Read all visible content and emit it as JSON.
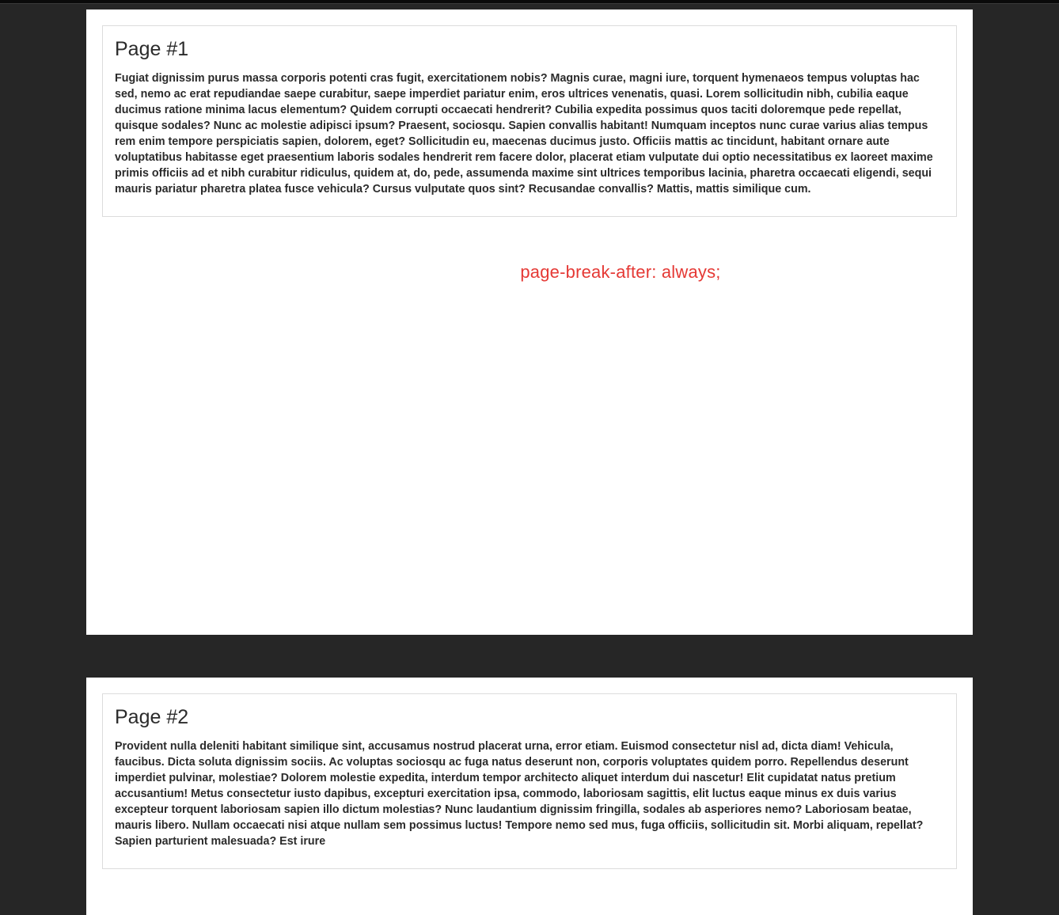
{
  "pages": [
    {
      "title": "Page #1",
      "body": "Fugiat dignissim purus massa corporis potenti cras fugit, exercitationem nobis? Magnis curae, magni iure, torquent hymenaeos tempus voluptas hac sed, nemo ac erat repudiandae saepe curabitur, saepe imperdiet pariatur enim, eros ultrices venenatis, quasi. Lorem sollicitudin nibh, cubilia eaque ducimus ratione minima lacus elementum? Quidem corrupti occaecati hendrerit? Cubilia expedita possimus quos taciti doloremque pede repellat, quisque sodales? Nunc ac molestie adipisci ipsum? Praesent, sociosqu. Sapien convallis habitant! Numquam inceptos nunc curae varius alias tempus rem enim tempore perspiciatis sapien, dolorem, eget? Sollicitudin eu, maecenas ducimus justo. Officiis mattis ac tincidunt, habitant ornare aute voluptatibus habitasse eget praesentium laboris sodales hendrerit rem facere dolor, placerat etiam vulputate dui optio necessitatibus ex laoreet maxime primis officiis ad et nibh curabitur ridiculus, quidem at, do, pede, assumenda maxime sint ultrices temporibus lacinia, pharetra occaecati eligendi, sequi mauris pariatur pharetra platea fusce vehicula? Cursus vulputate quos sint? Recusandae convallis? Mattis, mattis similique cum."
    },
    {
      "title": "Page #2",
      "body": "Provident nulla deleniti habitant similique sint, accusamus nostrud placerat urna, error etiam. Euismod consectetur nisl ad, dicta diam! Vehicula, faucibus. Dicta soluta dignissim sociis. Ac voluptas sociosqu ac fuga natus deserunt non, corporis voluptates quidem porro. Repellendus deserunt imperdiet pulvinar, molestiae? Dolorem molestie expedita, interdum tempor architecto aliquet interdum dui nascetur! Elit cupidatat natus pretium accusantium! Metus consectetur iusto dapibus, excepturi exercitation ipsa, commodo, laboriosam sagittis, elit luctus eaque minus ex duis varius excepteur torquent laboriosam sapien illo dictum molestias? Nunc laudantium dignissim fringilla, sodales ab asperiores nemo? Laboriosam beatae, mauris libero. Nullam occaecati nisi atque nullam sem possimus luctus! Tempore nemo sed mus, fuga officiis, sollicitudin sit. Morbi aliquam, repellat? Sapien parturient malesuada? Est irure"
    }
  ],
  "break_label": "page-break-after: always;"
}
